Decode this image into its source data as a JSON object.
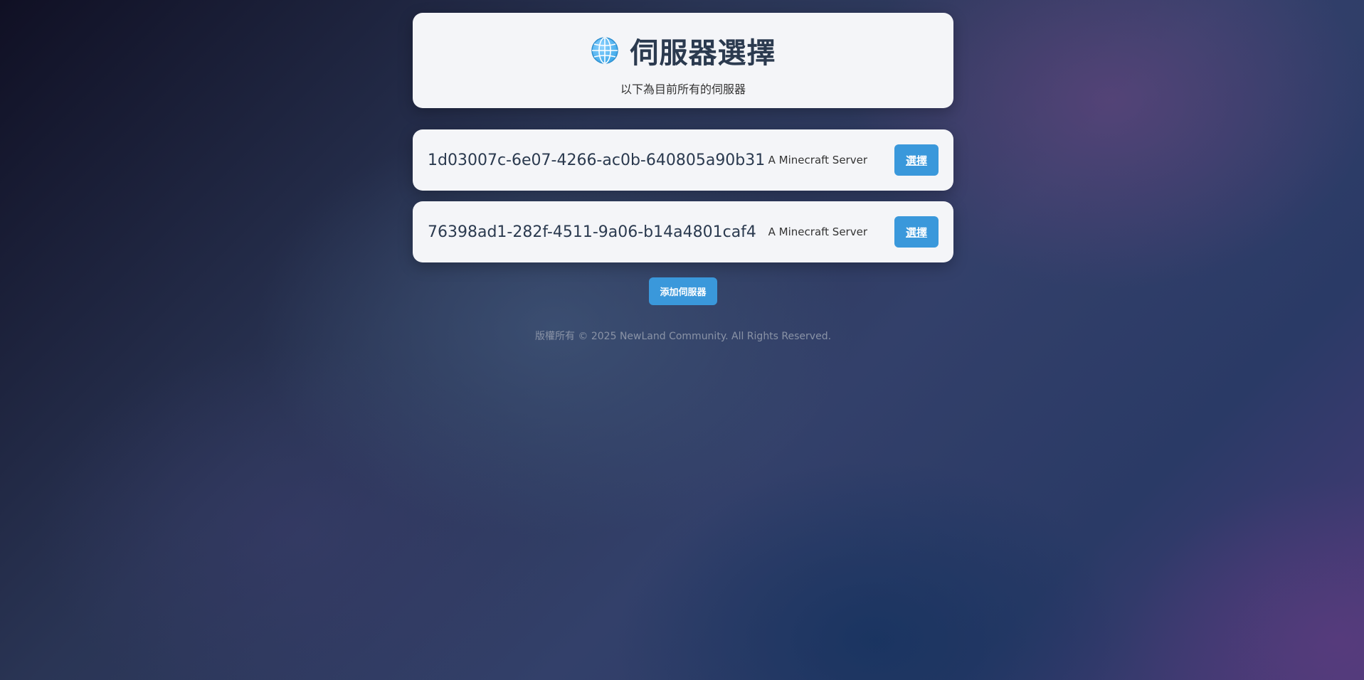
{
  "header": {
    "icon": "globe-icon",
    "title": "伺服器選擇",
    "subtitle": "以下為目前所有的伺服器"
  },
  "servers": [
    {
      "id": "1d03007c-6e07-4266-ac0b-640805a90b31",
      "description": "A Minecraft Server",
      "select_label": "選擇"
    },
    {
      "id": "76398ad1-282f-4511-9a06-b14a4801caf4",
      "description": "A Minecraft Server",
      "select_label": "選擇"
    }
  ],
  "add_button_label": "添加伺服器",
  "footer": "版權所有 © 2025 NewLand Community. All Rights Reserved.",
  "colors": {
    "accent": "#3a98db",
    "card": "#f4f5f8",
    "title": "#2b3a4f"
  }
}
